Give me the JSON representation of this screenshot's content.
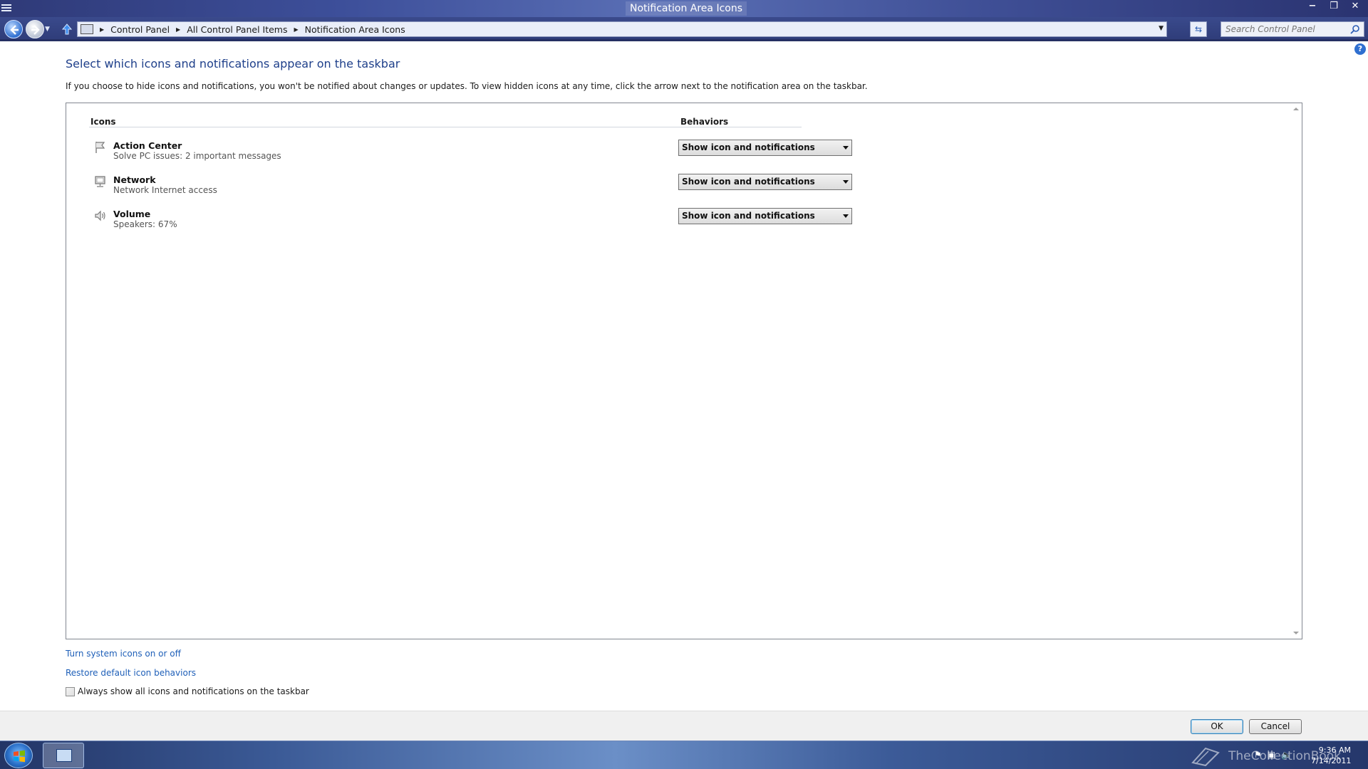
{
  "window": {
    "title": "Notification Area Icons",
    "controls": {
      "minimize": "−",
      "maximize": "❐",
      "close": "✕"
    }
  },
  "address_bar": {
    "breadcrumbs": [
      "Control Panel",
      "All Control Panel Items",
      "Notification Area Icons"
    ],
    "search_placeholder": "Search Control Panel"
  },
  "page": {
    "heading": "Select which icons and notifications appear on the taskbar",
    "intro": "If you choose to hide icons and notifications, you won't be notified about changes or updates. To view hidden icons at any time, click the arrow next to the notification area on the taskbar.",
    "columns": {
      "icons": "Icons",
      "behaviors": "Behaviors"
    },
    "rows": [
      {
        "icon": "flag-icon",
        "name": "Action Center",
        "desc": "Solve PC issues: 2 important messages",
        "behavior": "Show icon and notifications"
      },
      {
        "icon": "network-icon",
        "name": "Network",
        "desc": "Network  Internet access",
        "behavior": "Show icon and notifications"
      },
      {
        "icon": "speaker-icon",
        "name": "Volume",
        "desc": "Speakers: 67%",
        "behavior": "Show icon and notifications"
      }
    ],
    "links": {
      "system_icons": "Turn system icons on or off",
      "restore": "Restore default icon behaviors"
    },
    "always_show": {
      "label": "Always show all icons and notifications on the taskbar",
      "checked": false
    }
  },
  "footer": {
    "ok": "OK",
    "cancel": "Cancel"
  },
  "taskbar": {
    "watermark": "TheCollectionBook",
    "time": "9:36 AM",
    "date": "7/14/2011"
  },
  "colors": {
    "heading": "#1e3f8a",
    "link": "#1e5fb8",
    "titlebar": "#3d4f9a"
  }
}
